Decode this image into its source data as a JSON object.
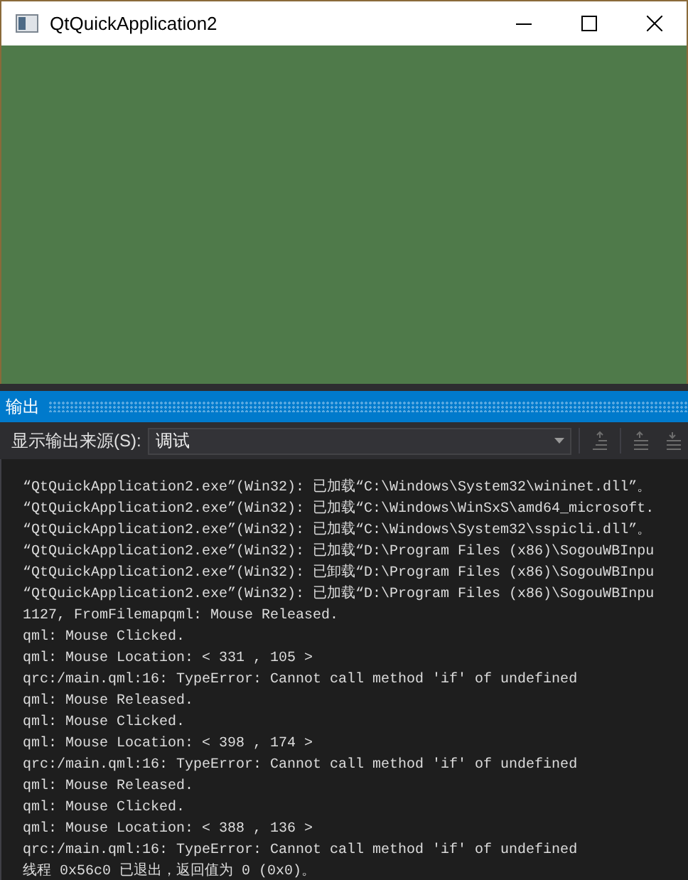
{
  "window": {
    "title": "QtQuickApplication2"
  },
  "output_panel": {
    "title": "输出",
    "source_label": "显示输出来源(S):",
    "source_value": "调试",
    "lines": [
      "“QtQuickApplication2.exe”(Win32): 已加载“C:\\Windows\\System32\\wininet.dll”。",
      "“QtQuickApplication2.exe”(Win32): 已加载“C:\\Windows\\WinSxS\\amd64_microsoft.",
      "“QtQuickApplication2.exe”(Win32): 已加载“C:\\Windows\\System32\\sspicli.dll”。",
      "“QtQuickApplication2.exe”(Win32): 已加载“D:\\Program Files (x86)\\SogouWBInpu",
      "“QtQuickApplication2.exe”(Win32): 已卸载“D:\\Program Files (x86)\\SogouWBInpu",
      "“QtQuickApplication2.exe”(Win32): 已加载“D:\\Program Files (x86)\\SogouWBInpu",
      "1127, FromFilemapqml: Mouse Released.",
      "qml: Mouse Clicked.",
      "qml: Mouse Location: < 331 , 105 >",
      "qrc:/main.qml:16: TypeError: Cannot call method 'if' of undefined",
      "qml: Mouse Released.",
      "qml: Mouse Clicked.",
      "qml: Mouse Location: < 398 , 174 >",
      "qrc:/main.qml:16: TypeError: Cannot call method 'if' of undefined",
      "qml: Mouse Released.",
      "qml: Mouse Clicked.",
      "qml: Mouse Location: < 388 , 136 >",
      "qrc:/main.qml:16: TypeError: Cannot call method 'if' of undefined",
      "线程 0x56c0 已退出，返回值为 0 (0x0)。"
    ]
  }
}
